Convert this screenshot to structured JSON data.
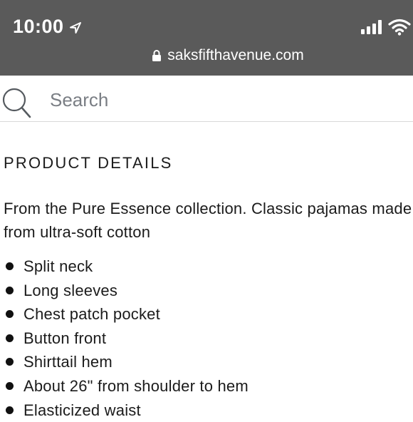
{
  "status_bar": {
    "time": "10:00",
    "url": "saksfifthavenue.com"
  },
  "search": {
    "placeholder": "Search"
  },
  "product_details": {
    "heading": "PRODUCT DETAILS",
    "description_line1": "From the Pure Essence collection. Classic pajamas made",
    "description_line2": "from ultra-soft cotton",
    "features": [
      "Split neck",
      "Long sleeves",
      "Chest patch pocket",
      "Button front",
      "Shirttail hem",
      "About 26\" from shoulder to hem",
      "Elasticized waist"
    ]
  },
  "icons": {
    "location": "location-arrow-icon",
    "signal": "cellular-signal-icon",
    "wifi": "wifi-icon",
    "lock": "lock-icon",
    "search": "search-icon"
  },
  "colors": {
    "status_bar_bg": "#5a5a5a",
    "text": "#1b1b1b",
    "placeholder": "#7a7e84",
    "divider": "#d9d9d9"
  }
}
